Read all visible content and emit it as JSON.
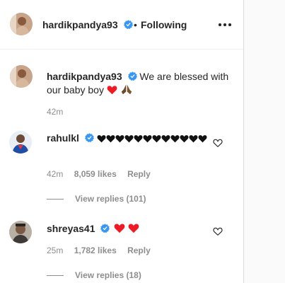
{
  "post_header": {
    "username": "hardikpandya93",
    "separator": "•",
    "follow_label": "Following"
  },
  "caption": {
    "username": "hardikpandya93",
    "text": "We are blessed with our baby boy",
    "emojis": [
      "red-heart",
      "folded-hands"
    ],
    "time": "42m"
  },
  "comments": [
    {
      "username": "rahulkl",
      "emojis": "black-heart x12",
      "time": "42m",
      "likes": "8,059 likes",
      "reply_label": "Reply",
      "view_replies": "View replies (101)"
    },
    {
      "username": "shreyas41",
      "emojis": "red-heart x2",
      "time": "25m",
      "likes": "1,782 likes",
      "reply_label": "Reply",
      "view_replies": "View replies (18)"
    }
  ],
  "colors": {
    "text": "#262626",
    "secondary": "#8e8e8e",
    "verified": "#3897f0",
    "red_heart": "#ed1c24",
    "black_heart": "#111111"
  },
  "icons": {
    "more": "more-options-icon",
    "verified": "verified-badge-icon",
    "like": "heart-outline-icon"
  }
}
